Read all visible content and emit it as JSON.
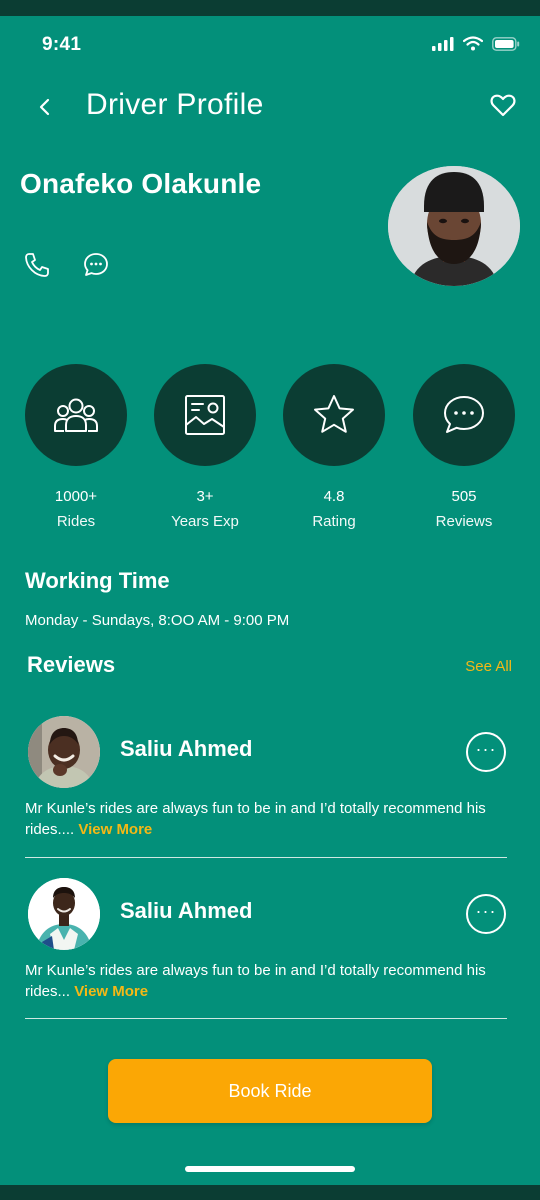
{
  "status_bar": {
    "time": "9:41"
  },
  "header": {
    "title": "Driver Profile"
  },
  "driver": {
    "name": "Onafeko Olakunle"
  },
  "stats": [
    {
      "icon": "users-icon",
      "value": "1000+",
      "label": "Rides"
    },
    {
      "icon": "image-frame-icon",
      "value": "3+",
      "label": "Years Exp"
    },
    {
      "icon": "star-icon",
      "value": "4.8",
      "label": "Rating"
    },
    {
      "icon": "chat-bubble-icon",
      "value": "505",
      "label": "Reviews"
    }
  ],
  "working_time": {
    "title": "Working Time",
    "hours": "Monday - Sundays, 8:OO AM - 9:00 PM"
  },
  "reviews": {
    "title": "Reviews",
    "see_all": "See All",
    "items": [
      {
        "name": "Saliu Ahmed",
        "text": "Mr Kunle’s rides are always fun to be in and I’d totally recommend his rides....",
        "link": "View More"
      },
      {
        "name": "Saliu Ahmed",
        "text": "Mr Kunle’s rides are always fun to be in and I’d totally recommend his rides...",
        "link": "View More"
      }
    ]
  },
  "actions": {
    "book_label": "Book Ride"
  },
  "colors": {
    "background": "#03907a",
    "dark": "#0b3d33",
    "accent": "#fba705",
    "link": "#f5b816"
  }
}
